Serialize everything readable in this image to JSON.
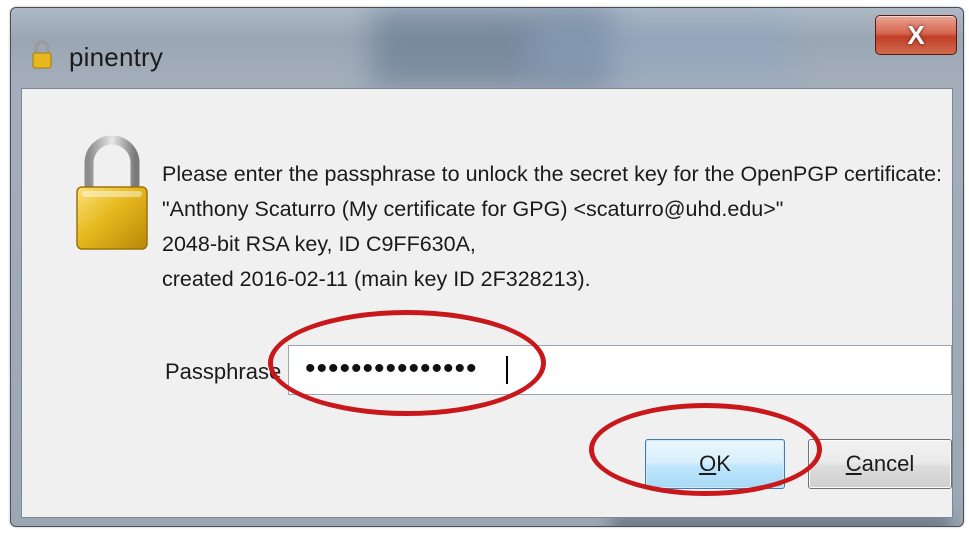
{
  "window": {
    "title": "pinentry",
    "close_label": "X"
  },
  "message": {
    "lines": [
      "Please enter the passphrase to unlock the secret key for the OpenPGP certificate:",
      "\"Anthony Scaturro (My certificate for GPG) <scaturro@uhd.edu>\"",
      "2048-bit RSA key, ID C9FF630A,",
      "created 2016-02-11 (main key ID 2F328213)."
    ]
  },
  "passphrase": {
    "label": "Passphrase",
    "masked_value": "•••••••••••••••"
  },
  "buttons": {
    "ok_accel": "O",
    "ok_rest": "K",
    "cancel_accel": "C",
    "cancel_rest": "ancel"
  },
  "colors": {
    "annotation": "#c8181b",
    "close_button": "#c23f28",
    "lock_gold": "#e6b81e"
  }
}
